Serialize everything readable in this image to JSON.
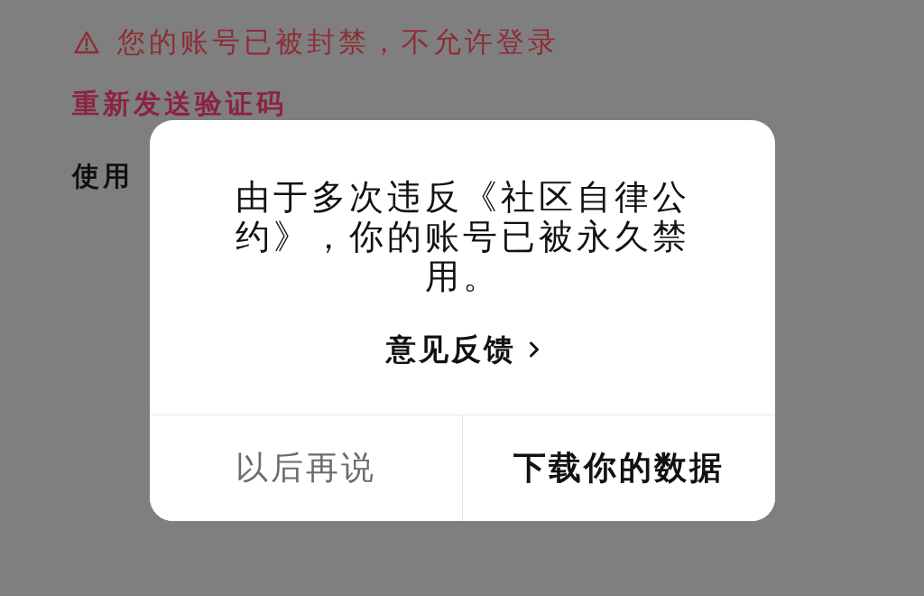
{
  "background": {
    "error": {
      "text": "您的账号已被封禁，不允许登录"
    },
    "resend_link": "重新发送验证码",
    "login_option": "使用"
  },
  "dialog": {
    "message": "由于多次违反《社区自律公约》，你的账号已被永久禁用。",
    "feedback_link": {
      "label": "意见反馈"
    },
    "buttons": [
      {
        "label": "以后再说",
        "kind": "secondary"
      },
      {
        "label": "下载你的数据",
        "kind": "primary"
      }
    ]
  }
}
